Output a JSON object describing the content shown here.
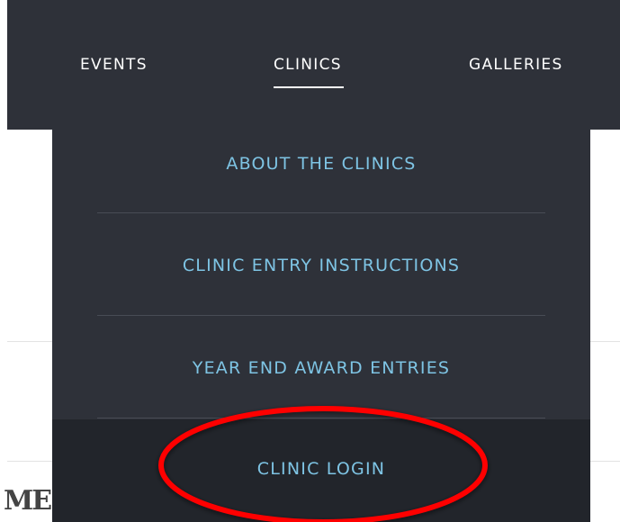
{
  "nav": {
    "items": [
      {
        "label": "EVENTS"
      },
      {
        "label": "CLINICS",
        "active": true
      },
      {
        "label": "GALLERIES"
      }
    ]
  },
  "dropdown": {
    "items": [
      {
        "label": "ABOUT THE CLINICS"
      },
      {
        "label": "CLINIC ENTRY INSTRUCTIONS"
      },
      {
        "label": "YEAR END AWARD ENTRIES"
      },
      {
        "label": "CLINIC LOGIN",
        "highlighted": true
      }
    ]
  },
  "page": {
    "partial_heading": "ME"
  },
  "colors": {
    "nav_bg": "#2e3139",
    "dropdown_text": "#7ec4e4",
    "highlight_ring": "#ff0000"
  }
}
